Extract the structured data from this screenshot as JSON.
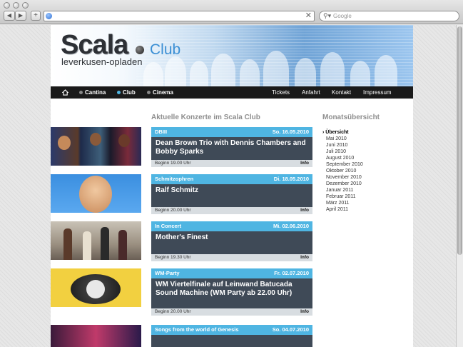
{
  "browser": {
    "back_label": "◀",
    "forward_label": "▶",
    "add_label": "+",
    "url": "",
    "search_placeholder": "Google"
  },
  "header": {
    "logo_name": "Scala",
    "logo_club": "Club",
    "logo_tagline": "leverkusen-opladen"
  },
  "nav": {
    "left": [
      {
        "label": "Cantina",
        "bullet_color": "#888888"
      },
      {
        "label": "Club",
        "bullet_color": "#4fb5e2"
      },
      {
        "label": "Cinema",
        "bullet_color": "#888888"
      }
    ],
    "right": [
      "Tickets",
      "Anfahrt",
      "Kontakt",
      "Impressum"
    ]
  },
  "main_title": "Aktuelle Konzerte im Scala Club",
  "sidebar": {
    "title": "Monatsübersicht",
    "months": [
      "Übersicht",
      "Mai 2010",
      "Juni 2010",
      "Juli 2010",
      "August 2010",
      "September 2010",
      "Oktober 2010",
      "November 2010",
      "Dezember 2010",
      "Januar 2011",
      "Februar 2011",
      "März 2011",
      "April 2011"
    ]
  },
  "events": [
    {
      "category": "DBIII",
      "date": "So. 16.05.2010",
      "title": "Dean Brown Trio with Dennis Chambers and Bobby Sparks",
      "begin": "Beginn 19.00 Uhr",
      "info": "Info"
    },
    {
      "category": "Schmitzophren",
      "date": "Di. 18.05.2010",
      "title": "Ralf Schmitz",
      "begin": "Beginn 20.00 Uhr",
      "info": "Info"
    },
    {
      "category": "In Concert",
      "date": "Mi. 02.06.2010",
      "title": "Mother's Finest",
      "begin": "Beginn 19.30 Uhr",
      "info": "Info"
    },
    {
      "category": "WM-Party",
      "date": "Fr. 02.07.2010",
      "title": "WM Viertelfinale auf Leinwand Batucada Sound Machine (WM Party ab 22.00 Uhr)",
      "begin": "Beginn 20.00 Uhr",
      "info": "Info"
    },
    {
      "category": "Songs from the world of Genesis",
      "date": "So. 04.07.2010",
      "title": "",
      "begin": "",
      "info": ""
    }
  ],
  "colors": {
    "accent_blue": "#4fb5e2",
    "event_body": "#3f4a57",
    "nav_bg": "#1a1a1a"
  }
}
